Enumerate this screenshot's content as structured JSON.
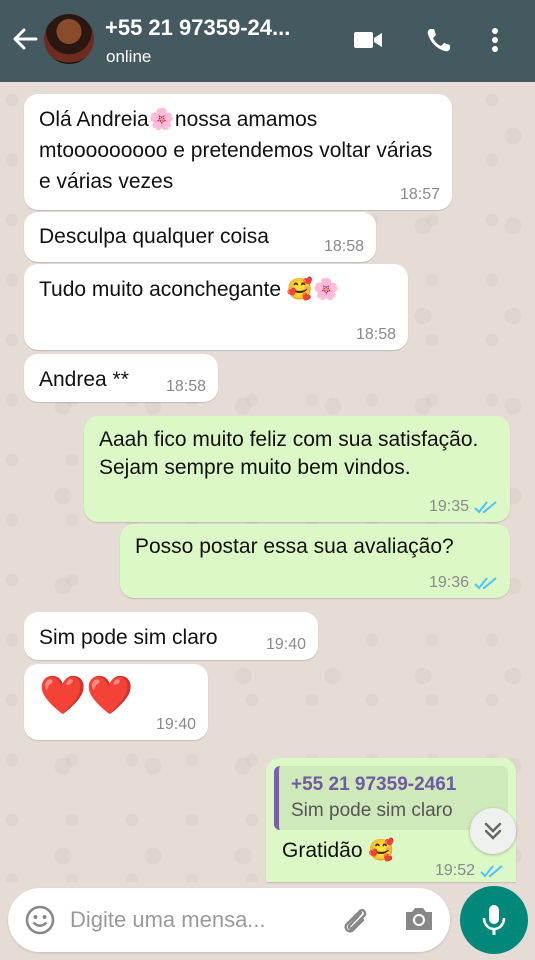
{
  "header": {
    "contact_name": "+55 21 97359-24...",
    "status": "online"
  },
  "messages": [
    {
      "dir": "in",
      "text": "Olá Andreia🌸nossa amamos mtooooooooo e pretendemos voltar várias e várias vezes",
      "time": "18:57"
    },
    {
      "dir": "in",
      "text": "Desculpa qualquer coisa",
      "time": "18:58"
    },
    {
      "dir": "in",
      "text": "Tudo muito aconchegante 🥰🌸",
      "time": "18:58"
    },
    {
      "dir": "in",
      "text": "Andrea **",
      "time": "18:58"
    },
    {
      "dir": "out",
      "text": "Aaah fico muito feliz com sua satisfação. Sejam sempre muito bem vindos.",
      "time": "19:35"
    },
    {
      "dir": "out",
      "text": "Posso postar essa sua avaliação?",
      "time": "19:36"
    },
    {
      "dir": "in",
      "text": "Sim pode sim claro",
      "time": "19:40"
    },
    {
      "dir": "in",
      "text": "❤️❤️",
      "time": "19:40"
    },
    {
      "dir": "out",
      "text": "Gratidão 🥰",
      "time": "19:52",
      "quote": {
        "name": "+55 21 97359-2461",
        "text": "Sim pode sim claro"
      }
    }
  ],
  "composer": {
    "placeholder": "Digite uma mensa..."
  },
  "colors": {
    "header": "#455a60",
    "outgoing": "#dcf8c6",
    "incoming": "#ffffff",
    "ticks": "#4fc3f7",
    "mic": "#00897b"
  },
  "icons": {
    "back": "back-arrow-icon",
    "video": "video-call-icon",
    "phone": "phone-icon",
    "menu": "more-vertical-icon",
    "emoji": "emoji-icon",
    "attach": "paperclip-icon",
    "camera": "camera-icon",
    "mic": "microphone-icon",
    "scroll": "double-chevron-down-icon"
  }
}
